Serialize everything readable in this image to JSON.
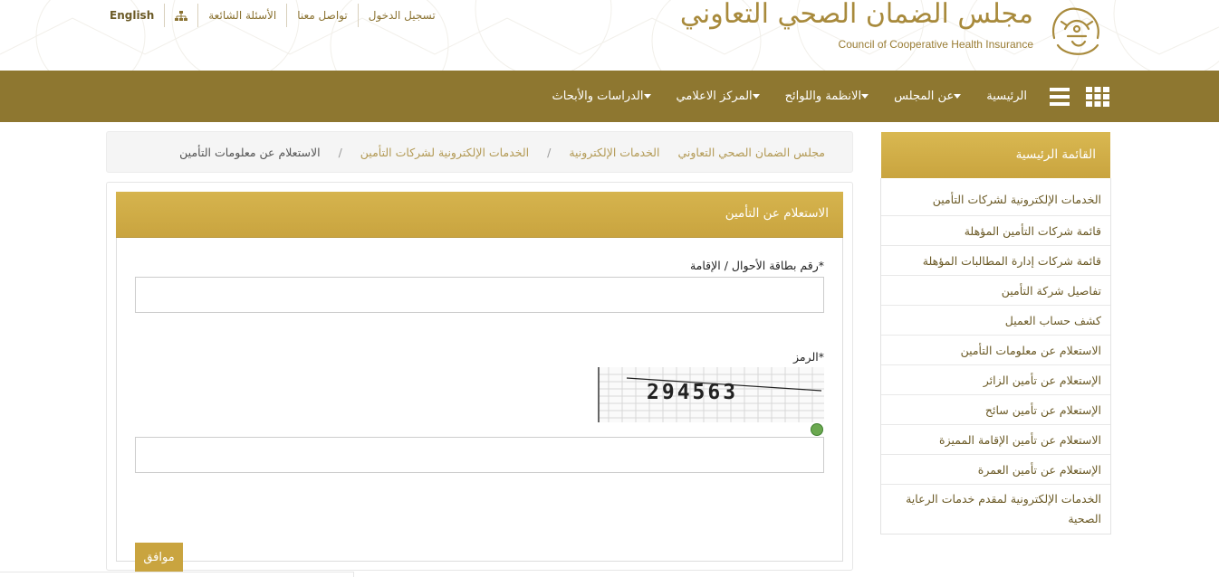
{
  "header": {
    "links": {
      "english": "English",
      "faq": "الأسئلة الشائعة",
      "contact": "تواصل معنا",
      "login": "تسجيل الدخول"
    },
    "logo": {
      "arabic_name": "مجلس الضمان الصحي التعاوني",
      "english_name": "Council of Cooperative Health Insurance"
    }
  },
  "nav": {
    "items": [
      {
        "label": "الرئيسية",
        "dropdown": false
      },
      {
        "label": "عن المجلس",
        "dropdown": true
      },
      {
        "label": "الانظمة واللوائح",
        "dropdown": true
      },
      {
        "label": "المركز الاعلامي",
        "dropdown": true
      },
      {
        "label": "الدراسات والأبحاث",
        "dropdown": true
      }
    ]
  },
  "breadcrumb": {
    "items": [
      "مجلس الضمان الصحي التعاوني",
      "الخدمات الإلكترونية",
      "الخدمات الإلكترونية لشركات التأمين"
    ],
    "current": "الاستعلام عن معلومات التأمين"
  },
  "form": {
    "title": "الاستعلام عن التأمين",
    "id_label": "رقم بطاقة الأحوال / الإقامة*",
    "id_value": "",
    "code_label": "الرمز*",
    "captcha_text": "294563",
    "code_value": "",
    "submit_label": "موافق"
  },
  "sidebar": {
    "title": "القائمة الرئيسية",
    "items": [
      "الخدمات الإلكترونية لشركات التأمين",
      "قائمة شركات التأمين المؤهلة",
      "قائمة شركات إدارة المطالبات المؤهلة",
      "تفاصيل شركة التأمين",
      "كشف حساب العميل",
      "الاستعلام عن معلومات التأمين",
      "الإستعلام عن تأمين الزائر",
      "الإستعلام عن تأمين سائح",
      "الاستعلام عن تأمين الإقامة المميزة",
      "الإستعلام عن تأمين العمرة",
      "الخدمات الإلكترونية لمقدم خدمات الرعاية الصحية"
    ]
  },
  "colors": {
    "nav_bg": "#8e7730",
    "gold": "#c9a43f",
    "link_gold": "#b39a55"
  }
}
